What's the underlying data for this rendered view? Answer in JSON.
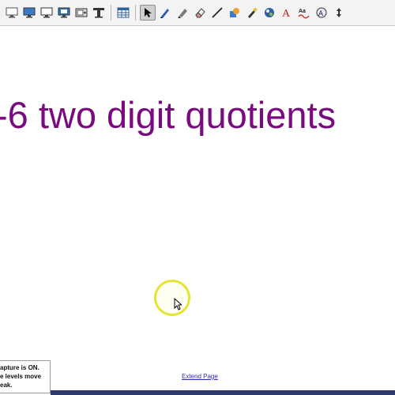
{
  "toolbar": {
    "tools": [
      {
        "icon": "screen-icon"
      },
      {
        "icon": "monitor-blue-icon"
      },
      {
        "icon": "monitor-icon"
      },
      {
        "icon": "monitor-capture-icon"
      },
      {
        "icon": "camera-icon"
      },
      {
        "icon": "crop-screen-icon"
      },
      {
        "icon": "table-icon"
      },
      {
        "icon": "select-arrow-icon",
        "active": true
      },
      {
        "icon": "pen-icon"
      },
      {
        "icon": "highlighter-icon"
      },
      {
        "icon": "eraser-icon"
      },
      {
        "icon": "line-icon"
      },
      {
        "icon": "shapes-icon"
      },
      {
        "icon": "magic-pen-icon"
      },
      {
        "icon": "fill-icon"
      },
      {
        "icon": "text-icon",
        "glyph": "A"
      },
      {
        "icon": "handwriting-recognition-icon"
      },
      {
        "icon": "shape-recognition-icon"
      },
      {
        "icon": "move-toolbar-icon",
        "glyph": "↕"
      }
    ]
  },
  "page": {
    "title_text": "-6 two digit quotients",
    "extend_link": "Extend Page"
  },
  "tooltip": {
    "lines": [
      "apture is ON.",
      "e levels move",
      "eak."
    ]
  },
  "colors": {
    "title": "#7a0a80",
    "highlight_ring": "#e4e437",
    "link": "#2a2ab0",
    "taskbar": "#2d3a6b"
  }
}
